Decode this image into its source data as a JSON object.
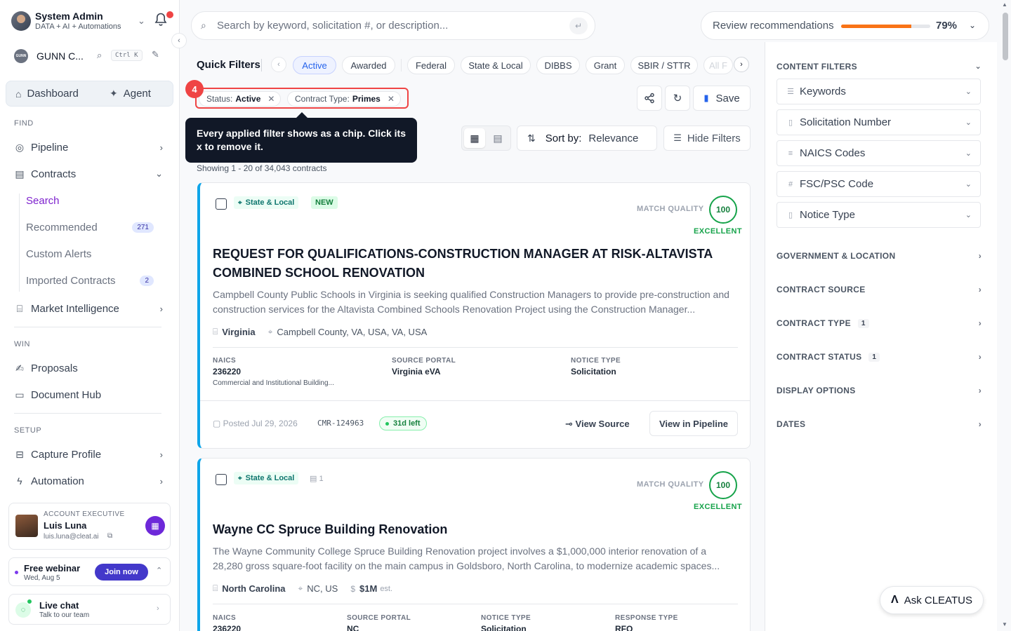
{
  "user": {
    "name": "System Admin",
    "subtitle": "DATA + AI + Automations"
  },
  "org": {
    "logo_text": "GUNN",
    "name": "GUNN C...",
    "shortcut": "Ctrl K"
  },
  "top_nav": {
    "dashboard": "Dashboard",
    "agent": "Agent"
  },
  "sidebar": {
    "find_label": "FIND",
    "pipeline": "Pipeline",
    "contracts": "Contracts",
    "contracts_sub": [
      {
        "label": "Search"
      },
      {
        "label": "Recommended",
        "count": "271"
      },
      {
        "label": "Custom Alerts"
      },
      {
        "label": "Imported Contracts",
        "count": "2"
      }
    ],
    "market_intel": "Market Intelligence",
    "win_label": "WIN",
    "proposals": "Proposals",
    "document_hub": "Document Hub",
    "setup_label": "SETUP",
    "capture_profile": "Capture Profile",
    "automation": "Automation"
  },
  "account_exec": {
    "role": "ACCOUNT EXECUTIVE",
    "name": "Luis Luna",
    "email": "luis.luna@cleat.ai"
  },
  "webinar": {
    "title": "Free webinar",
    "date": "Wed, Aug 5",
    "button": "Join now"
  },
  "live_chat": {
    "title": "Live chat",
    "subtitle": "Talk to our team"
  },
  "search": {
    "placeholder": "Search by keyword, solicitation #, or description..."
  },
  "review": {
    "label": "Review recommendations",
    "percent_text": "79%",
    "progress": 0.79,
    "progress_color": "#f97316"
  },
  "quick_filters": {
    "label": "Quick Filters",
    "chips": [
      "Active",
      "Awarded",
      "Federal",
      "State & Local",
      "DIBBS",
      "Grant",
      "SBIR / STTR",
      "All F"
    ]
  },
  "applied_filters": [
    {
      "key": "Status:",
      "value": "Active"
    },
    {
      "key": "Contract Type:",
      "value": "Primes"
    }
  ],
  "tour": {
    "step": "4",
    "text": "Every applied filter shows as a chip. Click its x to remove it."
  },
  "toolbar": {
    "save": "Save",
    "sort_label": "Sort by:",
    "sort_value": "Relevance",
    "hide_filters": "Hide Filters"
  },
  "results": {
    "showing": "Showing 1 - 20 of 34,043 contracts"
  },
  "cards": [
    {
      "tag": "State & Local",
      "badge": "NEW",
      "mq_label": "MATCH QUALITY",
      "score": "100",
      "score_text": "EXCELLENT",
      "title": "REQUEST FOR QUALIFICATIONS-CONSTRUCTION MANAGER AT RISK-ALTAVISTA COMBINED SCHOOL RENOVATION",
      "description": "Campbell County Public Schools in Virginia is seeking qualified Construction Managers to provide pre-construction and construction services for the Altavista Combined Schools Renovation Project using the Construction Manager...",
      "agency": "Virginia",
      "location": "Campbell County, VA, USA, VA, USA",
      "naics_label": "NAICS",
      "naics": "236220",
      "naics_desc": "Commercial and Institutional Building...",
      "portal_label": "SOURCE PORTAL",
      "portal": "Virginia eVA",
      "notice_label": "NOTICE TYPE",
      "notice": "Solicitation",
      "posted": "Posted Jul 29, 2026",
      "id": "CMR-124963",
      "days_left": "31d left",
      "view_source": "View Source",
      "view_pipeline": "View in Pipeline"
    },
    {
      "tag": "State & Local",
      "doc_count": "1",
      "mq_label": "MATCH QUALITY",
      "score": "100",
      "score_text": "EXCELLENT",
      "title": "Wayne CC Spruce Building Renovation",
      "description": "The Wayne Community College Spruce Building Renovation project involves a $1,000,000 interior renovation of a 28,280 gross square-foot facility on the main campus in Goldsboro, North Carolina, to modernize academic spaces...",
      "agency": "North Carolina",
      "location": "NC, US",
      "value": "$1M",
      "value_note": "est.",
      "naics_label": "NAICS",
      "naics": "236220",
      "portal_label": "SOURCE PORTAL",
      "portal": "NC",
      "notice_label": "NOTICE TYPE",
      "notice": "Solicitation",
      "response_label": "RESPONSE TYPE",
      "response": "RFQ"
    }
  ],
  "content_filters": {
    "title": "CONTENT FILTERS",
    "fields": [
      "Keywords",
      "Solicitation Number",
      "NAICS Codes",
      "FSC/PSC Code",
      "Notice Type"
    ],
    "groups": [
      {
        "label": "GOVERNMENT & LOCATION"
      },
      {
        "label": "CONTRACT SOURCE"
      },
      {
        "label": "CONTRACT TYPE",
        "count": "1"
      },
      {
        "label": "CONTRACT STATUS",
        "count": "1"
      },
      {
        "label": "DISPLAY OPTIONS"
      },
      {
        "label": "DATES"
      }
    ]
  },
  "ask": {
    "label": "Ask CLEATUS"
  },
  "colors": {
    "accent": "#2563eb",
    "purple": "#7e22ce",
    "excellent": "#16a34a",
    "highlight": "#ef4444",
    "card_border": "#0ea5e9"
  }
}
